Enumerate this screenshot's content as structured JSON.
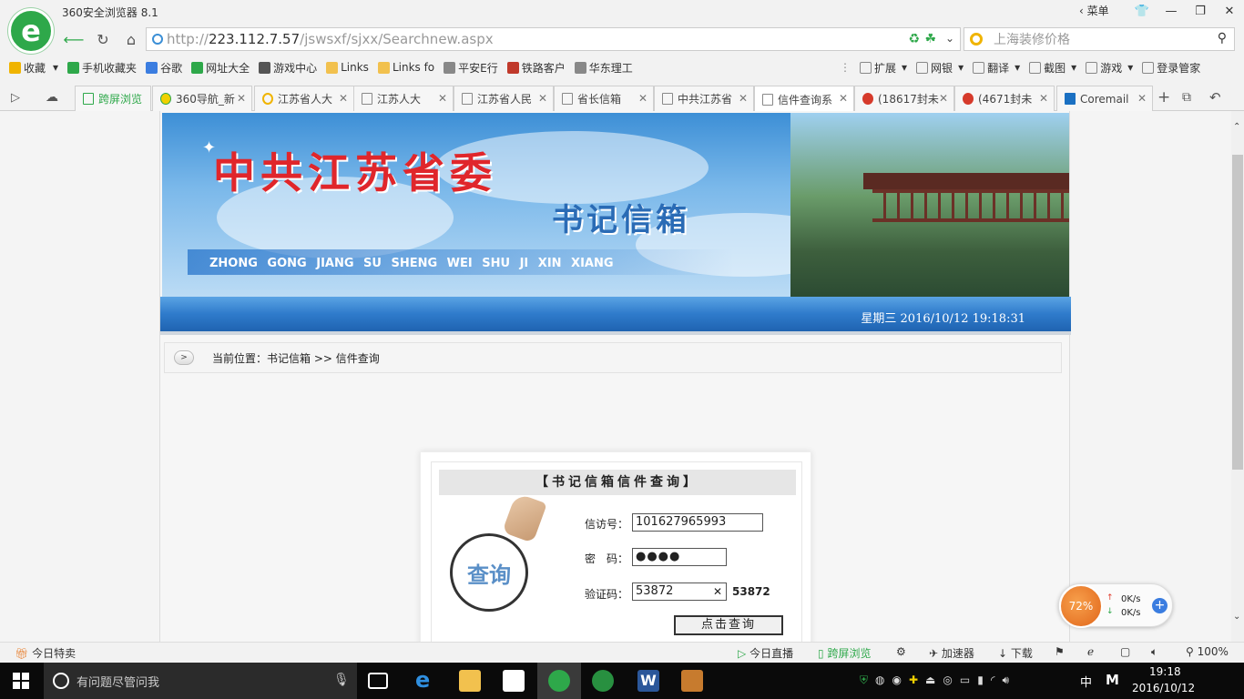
{
  "window": {
    "app_title": "360安全浏览器 8.1",
    "menu_label": "菜单"
  },
  "address": {
    "url_prefix": "http://",
    "url_host": "223.112.7.57",
    "url_path": "/jswsxf/sjxx/Searchnew.aspx",
    "search_placeholder": "上海装修价格"
  },
  "bookmarks": {
    "left": [
      {
        "label": "收藏",
        "icon": "star-icon",
        "color": "#f0b400"
      },
      {
        "label": "手机收藏夹",
        "icon": "phone-icon",
        "color": "#2ea84a"
      },
      {
        "label": "谷歌",
        "icon": "google-icon",
        "color": "#3b7de0"
      },
      {
        "label": "网址大全",
        "icon": "nav-icon",
        "color": "#2ea84a"
      },
      {
        "label": "游戏中心",
        "icon": "gamepad-icon",
        "color": "#555555"
      },
      {
        "label": "Links",
        "icon": "folder-icon",
        "color": "#f2c14e"
      },
      {
        "label": "Links fo",
        "icon": "folder-icon",
        "color": "#f2c14e"
      },
      {
        "label": "平安E行",
        "icon": "page-icon",
        "color": "#888888"
      },
      {
        "label": "铁路客户",
        "icon": "rail-icon",
        "color": "#c0392b"
      },
      {
        "label": "华东理工",
        "icon": "page-icon",
        "color": "#888888"
      }
    ],
    "right": [
      {
        "label": "扩展",
        "icon": "extension-icon"
      },
      {
        "label": "网银",
        "icon": "bank-icon"
      },
      {
        "label": "翻译",
        "icon": "translate-icon"
      },
      {
        "label": "截图",
        "icon": "screenshot-icon"
      },
      {
        "label": "游戏",
        "icon": "game-icon"
      },
      {
        "label": "登录管家",
        "icon": "login-icon"
      }
    ]
  },
  "tabs": [
    {
      "label": "跨屏浏览",
      "icon": "phone-icon",
      "active": false
    },
    {
      "label": "360导航_新",
      "icon": "nav-icon",
      "active": false
    },
    {
      "label": "江苏省人大",
      "icon": "search-icon",
      "active": false
    },
    {
      "label": "江苏人大",
      "icon": "page-icon",
      "active": false
    },
    {
      "label": "江苏省人民",
      "icon": "page-icon",
      "active": false
    },
    {
      "label": "省长信箱",
      "icon": "page-icon",
      "active": false
    },
    {
      "label": "中共江苏省",
      "icon": "page-icon",
      "active": false
    },
    {
      "label": "信件查询系",
      "icon": "page-icon",
      "active": true
    },
    {
      "label": "(18617封未",
      "icon": "mail-icon",
      "active": false
    },
    {
      "label": "(4671封未",
      "icon": "mail-icon",
      "active": false
    },
    {
      "label": "Coremail",
      "icon": "coremail-icon",
      "active": false
    }
  ],
  "banner": {
    "title": "中共江苏省委",
    "subtitle": "书记信箱",
    "pinyin": "ZHONG GONG JIANG SU SHENG WEI SHU JI XIN XIANG",
    "datetime": "星期三  2016/10/12  19:18:31"
  },
  "breadcrumb": "当前位置：书记信箱 >> 信件查询",
  "query": {
    "title": "【书记信箱信件查询】",
    "magnifier_text": "查询",
    "petition_label": "信访号：",
    "petition_value": "101627965993",
    "password_label": "密　码：",
    "password_value": "●●●●",
    "captcha_label": "验证码：",
    "captcha_value": "53872",
    "captcha_image_text": "53872",
    "submit_label": "点击查询"
  },
  "speed_widget": {
    "percent": "72%",
    "up": "0K/s",
    "down": "0K/s"
  },
  "statusbar": {
    "left": "今日特卖",
    "items": [
      "今日直播",
      "跨屏浏览",
      "加速器",
      "下载"
    ],
    "zoom": "100%"
  },
  "taskbar": {
    "search_placeholder": "有问题尽管问我",
    "ime": "中",
    "time": "19:18",
    "date": "2016/10/12"
  }
}
